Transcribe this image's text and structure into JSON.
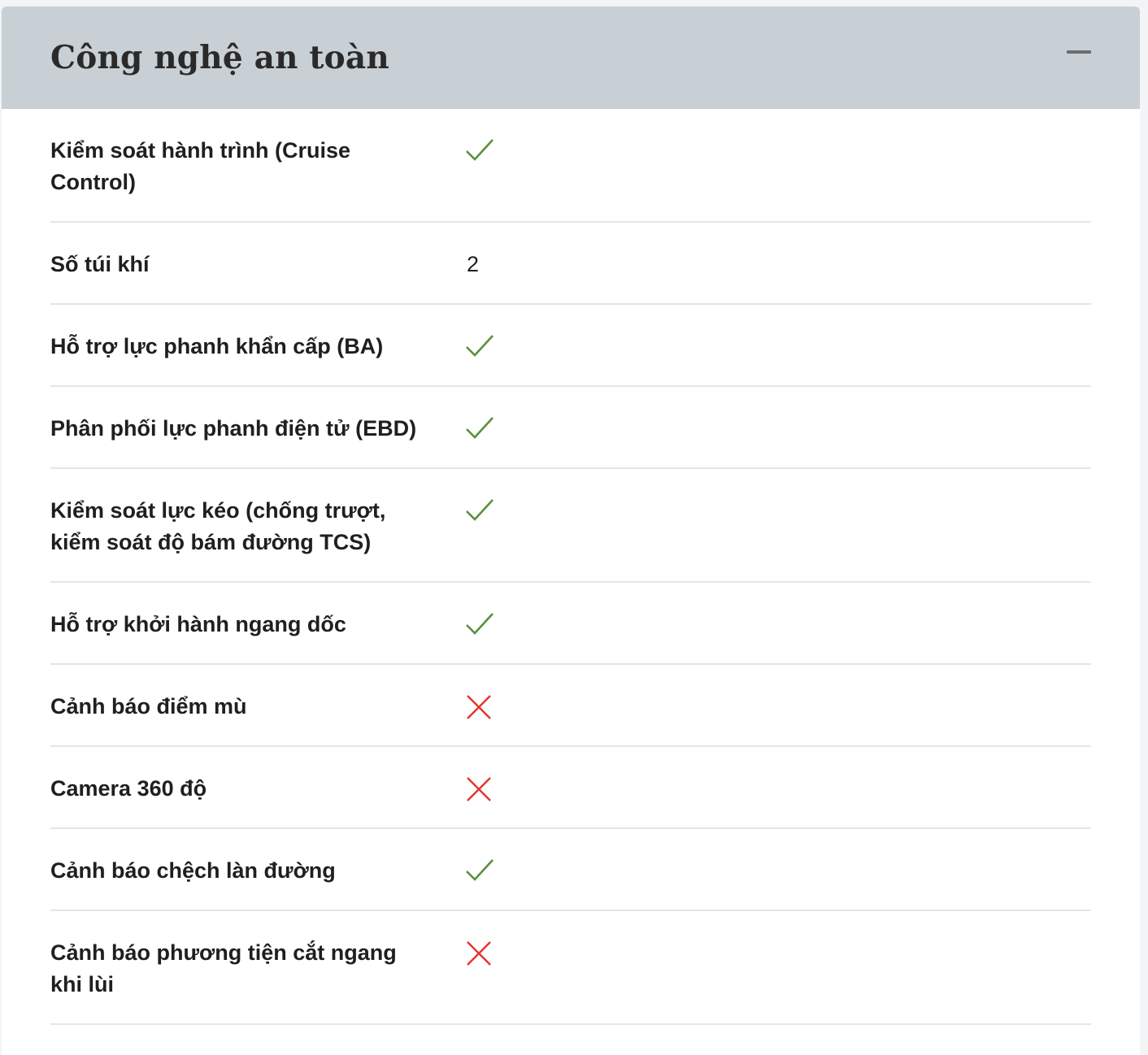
{
  "section": {
    "title": "Công nghệ an toàn",
    "toggle": "collapse"
  },
  "colors": {
    "header_bg": "#c8d0d5",
    "check": "#5a8f3c",
    "cross": "#e8322b"
  },
  "rows": [
    {
      "label": "Kiểm soát hành trình (Cruise Control)",
      "value_type": "check"
    },
    {
      "label": "Số túi khí",
      "value_type": "text",
      "value": "2"
    },
    {
      "label": "Hỗ trợ lực phanh khẩn cấp (BA)",
      "value_type": "check"
    },
    {
      "label": "Phân phối lực phanh điện tử (EBD)",
      "value_type": "check"
    },
    {
      "label": "Kiểm soát lực kéo (chống trượt, kiểm soát độ bám đường TCS)",
      "value_type": "check"
    },
    {
      "label": "Hỗ trợ khởi hành ngang dốc",
      "value_type": "check"
    },
    {
      "label": "Cảnh báo điểm mù",
      "value_type": "cross"
    },
    {
      "label": "Camera 360 độ",
      "value_type": "cross"
    },
    {
      "label": "Cảnh báo chệch làn đường",
      "value_type": "check"
    },
    {
      "label": "Cảnh báo phương tiện cắt ngang khi lùi",
      "value_type": "cross"
    }
  ]
}
